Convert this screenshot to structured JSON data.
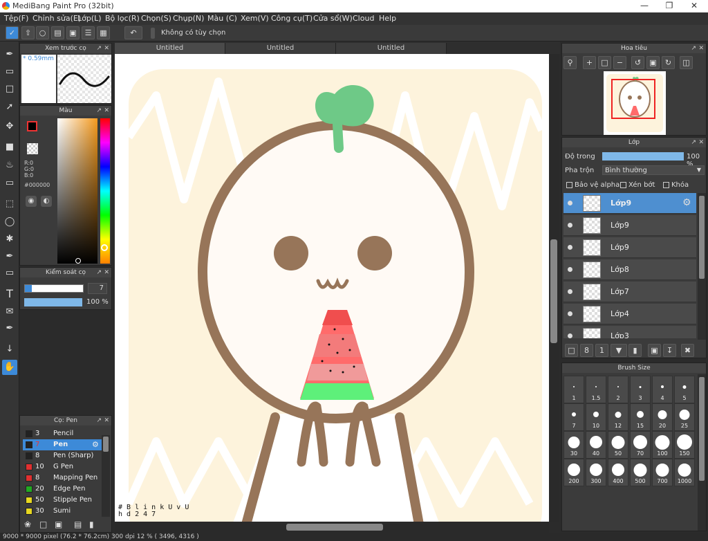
{
  "window": {
    "title": "MediBang Paint Pro (32bit)"
  },
  "menubar": [
    "Tệp(F)",
    "Chỉnh sửa(E)",
    "Lớp(L)",
    "Bộ lọc(R)",
    "Chọn(S)",
    "Chụp(N)",
    "Màu (C)",
    "Xem(V)",
    "Công cụ(T)",
    "Cửa sổ(W)",
    "Cloud",
    "Help"
  ],
  "toolbar": {
    "no_options_label": "Không có tùy chọn"
  },
  "brush_preview": {
    "title": "Xem trước cọ",
    "size": "* 0.59mm"
  },
  "color_panel": {
    "title": "Màu",
    "r": "R:0",
    "g": "G:0",
    "b": "B:0",
    "hex": "#000000"
  },
  "brush_control": {
    "title": "Kiểm soát cọ",
    "size_value": "7",
    "opacity_value": "100 %"
  },
  "brush_list": {
    "title": "Cọ: Pen",
    "items": [
      {
        "num": "3",
        "name": "Pencil",
        "color": "#222222"
      },
      {
        "num": "7",
        "name": "Pen",
        "color": "#222222"
      },
      {
        "num": "8",
        "name": "Pen (Sharp)",
        "color": "#222222"
      },
      {
        "num": "10",
        "name": "G Pen",
        "color": "#e03030"
      },
      {
        "num": "8",
        "name": "Mapping Pen",
        "color": "#e03030"
      },
      {
        "num": "20",
        "name": "Edge Pen",
        "color": "#22aa22"
      },
      {
        "num": "50",
        "name": "Stipple Pen",
        "color": "#e8d820"
      },
      {
        "num": "30",
        "name": "Sumi",
        "color": "#e8d820"
      }
    ]
  },
  "tabs": [
    "Untitled",
    "Untitled",
    "Untitled"
  ],
  "canvas": {
    "watermark_line1": "# B l i n k U v U",
    "watermark_line2": "h d 2 4 7"
  },
  "navigator": {
    "title": "Hoa tiêu"
  },
  "layers": {
    "title": "Lớp",
    "opacity_label": "Độ trong",
    "opacity_value": "100 %",
    "blend_label": "Pha trộn",
    "blend_value": "Bình thường",
    "alpha_protect": "Bảo vệ alpha",
    "clipping": "Xén bớt",
    "lock": "Khóa",
    "items": [
      {
        "name": "Lớp9"
      },
      {
        "name": "Lớp9"
      },
      {
        "name": "Lớp9"
      },
      {
        "name": "Lớp8"
      },
      {
        "name": "Lớp7"
      },
      {
        "name": "Lớp4"
      },
      {
        "name": "Lớp3"
      }
    ]
  },
  "brush_size": {
    "title": "Brush Size",
    "sizes": [
      "1",
      "1.5",
      "2",
      "3",
      "4",
      "5",
      "7",
      "10",
      "12",
      "15",
      "20",
      "25",
      "30",
      "40",
      "50",
      "70",
      "100",
      "150",
      "200",
      "300",
      "400",
      "500",
      "700",
      "1000"
    ]
  },
  "status": {
    "text": "9000 * 9000 pixel   (76.2 * 76.2cm)   300 dpi   12 %   ( 3496, 4316 )"
  }
}
